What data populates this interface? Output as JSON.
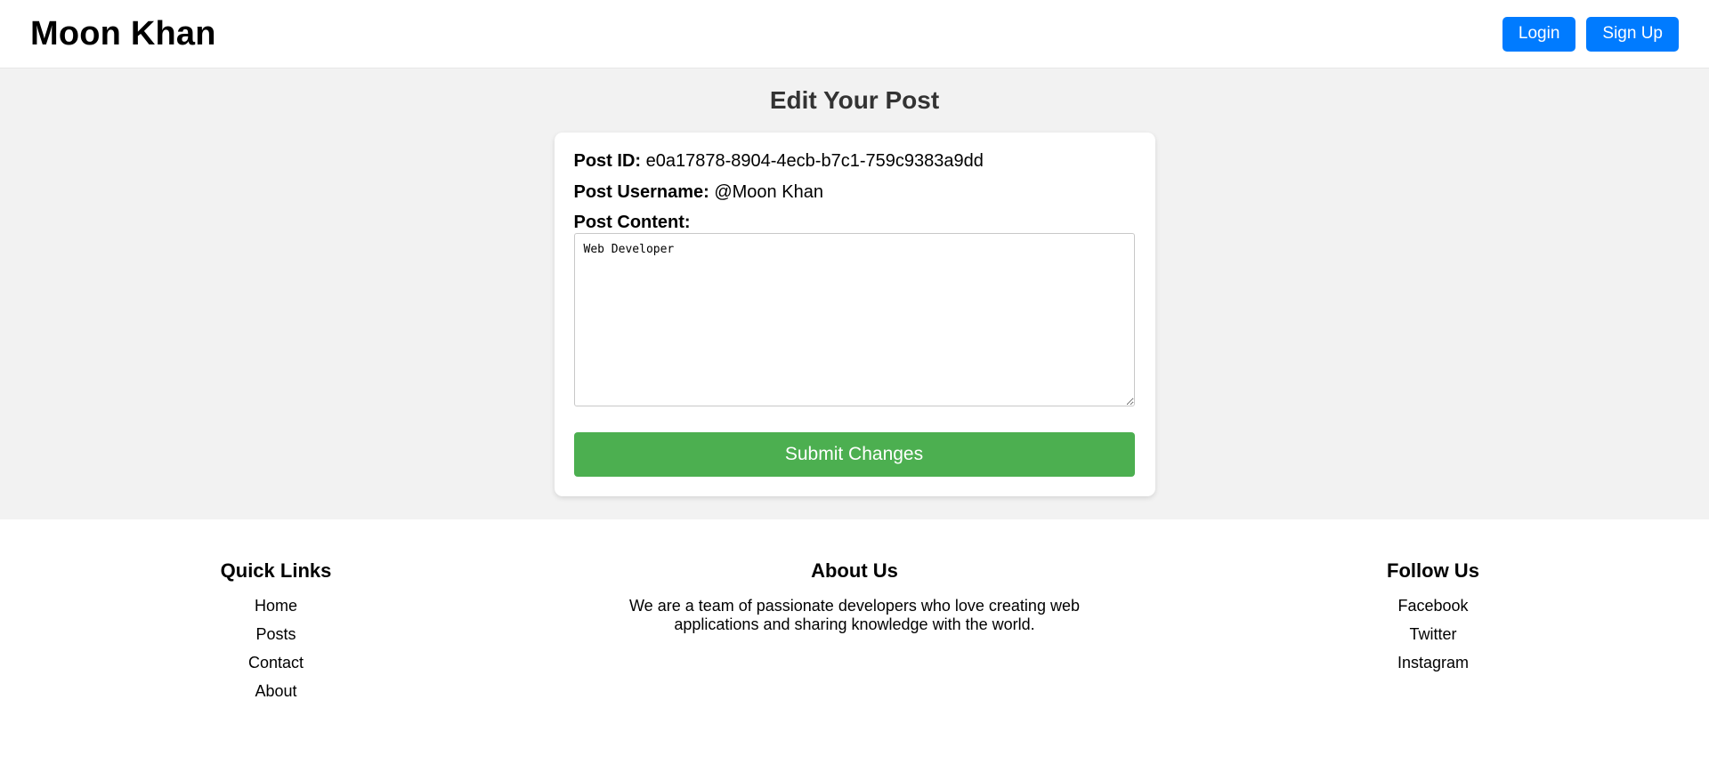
{
  "header": {
    "brand": "Moon Khan",
    "login_label": "Login",
    "signup_label": "Sign Up"
  },
  "main": {
    "title": "Edit Your Post",
    "post_id_label": "Post ID:",
    "post_id_value": "e0a17878-8904-4ecb-b7c1-759c9383a9dd",
    "post_username_label": "Post Username:",
    "post_username_value": "@Moon Khan",
    "post_content_label": "Post Content:",
    "post_content_value": "Web Developer",
    "submit_label": "Submit Changes"
  },
  "footer": {
    "quick_links": {
      "title": "Quick Links",
      "items": [
        "Home",
        "Posts",
        "Contact",
        "About"
      ]
    },
    "about": {
      "title": "About Us",
      "text": "We are a team of passionate developers who love creating web applications and sharing knowledge with the world."
    },
    "follow": {
      "title": "Follow Us",
      "items": [
        "Facebook",
        "Twitter",
        "Instagram"
      ]
    }
  },
  "colors": {
    "primary_button": "#007bff",
    "submit_button": "#4caf50",
    "main_background": "#f2f2f2"
  }
}
